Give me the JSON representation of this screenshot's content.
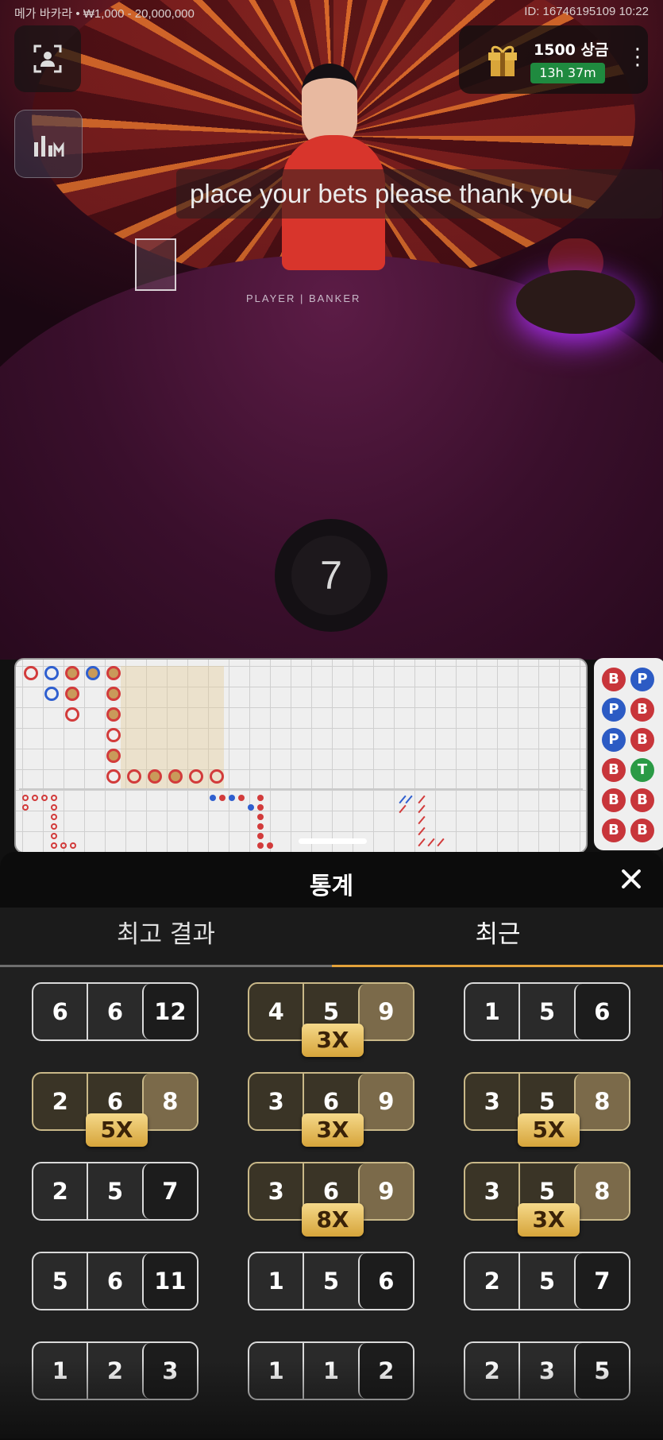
{
  "header": {
    "table_info": "메가 바카라 • ₩1,000 - 20,000,000",
    "game_id": "ID: 16746195109 10:22"
  },
  "prize": {
    "amount": "1500 상금",
    "countdown": "13h 37m"
  },
  "dealer_caption": "place your bets please thank you",
  "table_label": "PLAYER | BANKER",
  "bet_timer": "7",
  "side_road": [
    [
      "B",
      "P"
    ],
    [
      "P",
      "B"
    ],
    [
      "P",
      "B"
    ],
    [
      "B",
      "T"
    ],
    [
      "B",
      "B"
    ],
    [
      "B",
      "B"
    ]
  ],
  "stats": {
    "title": "통계",
    "tabs": [
      {
        "label": "최고 결과",
        "active": false
      },
      {
        "label": "최근",
        "active": true
      }
    ],
    "results": [
      {
        "d1": "6",
        "d2": "6",
        "total": "12",
        "multiplier": ""
      },
      {
        "d1": "4",
        "d2": "5",
        "total": "9",
        "multiplier": "3X"
      },
      {
        "d1": "1",
        "d2": "5",
        "total": "6",
        "multiplier": ""
      },
      {
        "d1": "2",
        "d2": "6",
        "total": "8",
        "multiplier": "5X"
      },
      {
        "d1": "3",
        "d2": "6",
        "total": "9",
        "multiplier": "3X"
      },
      {
        "d1": "3",
        "d2": "5",
        "total": "8",
        "multiplier": "5X"
      },
      {
        "d1": "2",
        "d2": "5",
        "total": "7",
        "multiplier": ""
      },
      {
        "d1": "3",
        "d2": "6",
        "total": "9",
        "multiplier": "8X"
      },
      {
        "d1": "3",
        "d2": "5",
        "total": "8",
        "multiplier": "3X"
      },
      {
        "d1": "5",
        "d2": "6",
        "total": "11",
        "multiplier": ""
      },
      {
        "d1": "1",
        "d2": "5",
        "total": "6",
        "multiplier": ""
      },
      {
        "d1": "2",
        "d2": "5",
        "total": "7",
        "multiplier": ""
      },
      {
        "d1": "1",
        "d2": "2",
        "total": "3",
        "multiplier": ""
      },
      {
        "d1": "1",
        "d2": "1",
        "total": "2",
        "multiplier": ""
      },
      {
        "d1": "2",
        "d2": "3",
        "total": "5",
        "multiplier": ""
      }
    ]
  },
  "icons": {
    "profile": "person-frame-icon",
    "stats": "bar-chart-icon",
    "prize": "gift-icon",
    "menu": "more-vertical-icon",
    "close": "close-icon"
  }
}
